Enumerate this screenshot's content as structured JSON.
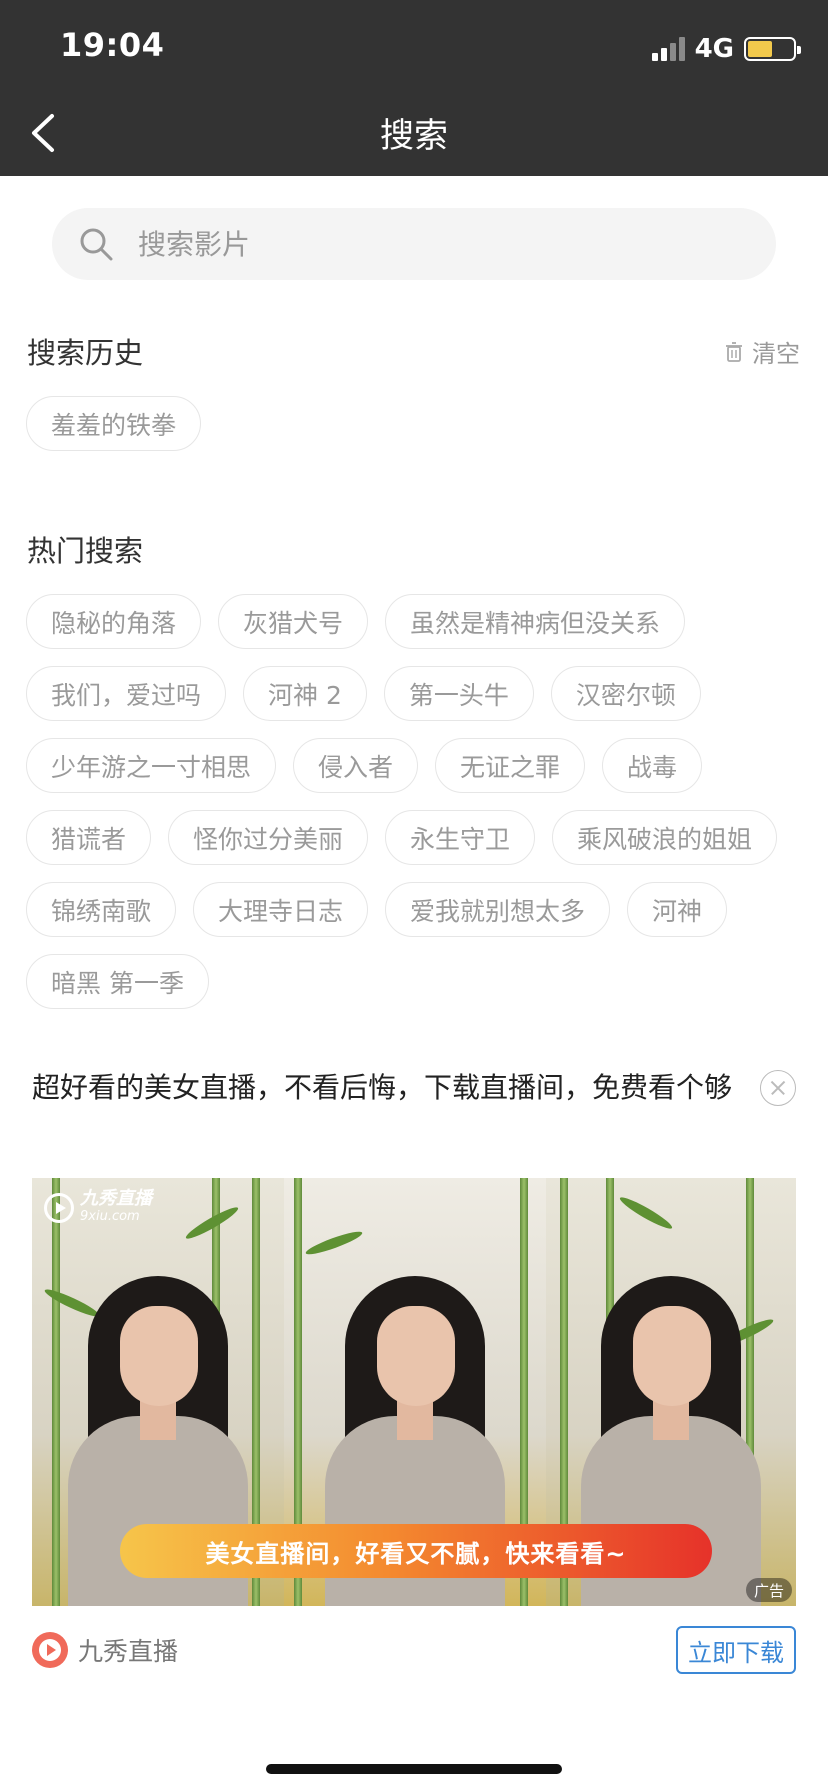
{
  "status_bar": {
    "time": "19:04",
    "network": "4G"
  },
  "nav": {
    "title": "搜索",
    "back_icon": "chevron-left-icon"
  },
  "search": {
    "placeholder": "搜索影片",
    "value": ""
  },
  "history": {
    "title": "搜索历史",
    "clear_label": "清空",
    "items": [
      "羞羞的铁拳"
    ]
  },
  "hot": {
    "title": "热门搜索",
    "items": [
      "隐秘的角落",
      "灰猎犬号",
      "虽然是精神病但没关系",
      "我们，爱过吗",
      "河神 2",
      "第一头牛",
      "汉密尔顿",
      "少年游之一寸相思",
      "侵入者",
      "无证之罪",
      "战毒",
      "猎谎者",
      "怪你过分美丽",
      "永生守卫",
      "乘风破浪的姐姐",
      "锦绣南歌",
      "大理寺日志",
      "爱我就别想太多",
      "河神",
      "暗黑 第一季"
    ]
  },
  "ad": {
    "text": "超好看的美女直播，不看后悔，下载直播间，免费看个够",
    "image_logo_name": "九秀直播",
    "image_logo_url": "9xiu.com",
    "banner_text": "美女直播间，好看又不腻，快来看看~",
    "ad_label": "广告",
    "advertiser": "九秀直播",
    "cta": "立即下载"
  },
  "colors": {
    "header_bg": "#333333",
    "tag_text": "#9a9a9a",
    "cta_blue": "#3a87d6"
  }
}
